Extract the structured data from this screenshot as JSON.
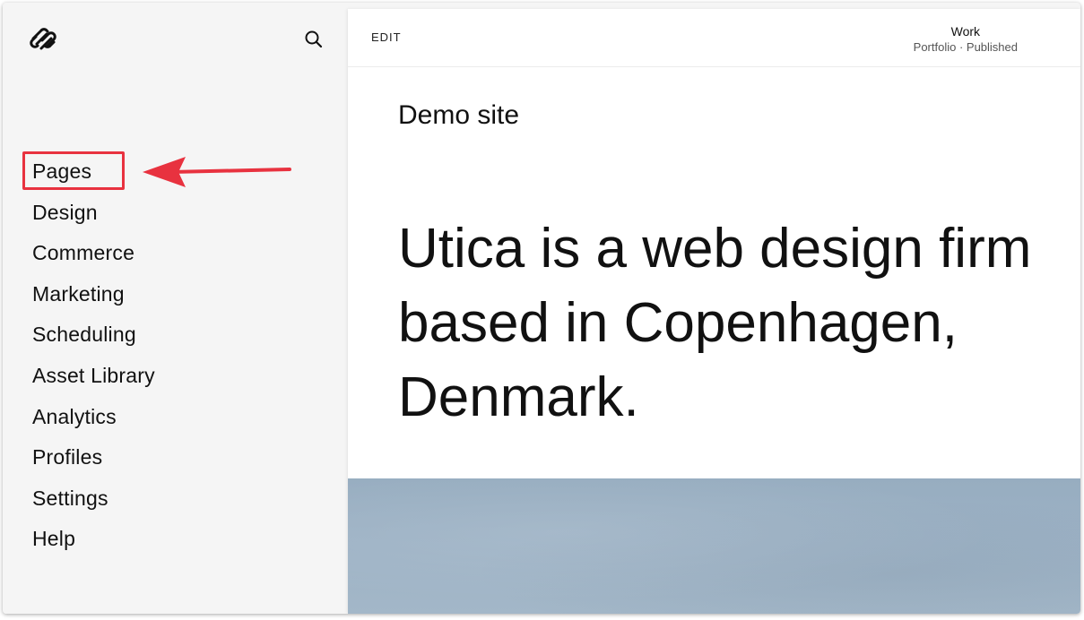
{
  "sidebar": {
    "logo_icon": "squarespace-logo-icon",
    "search_icon": "search-icon",
    "items": [
      {
        "label": "Pages"
      },
      {
        "label": "Design"
      },
      {
        "label": "Commerce"
      },
      {
        "label": "Marketing"
      },
      {
        "label": "Scheduling"
      },
      {
        "label": "Asset Library"
      },
      {
        "label": "Analytics"
      },
      {
        "label": "Profiles"
      },
      {
        "label": "Settings"
      },
      {
        "label": "Help"
      }
    ],
    "highlighted_item": "Pages"
  },
  "annotation": {
    "color": "#e8323f",
    "shape": "box-and-arrow"
  },
  "topbar": {
    "edit_label": "EDIT",
    "page_name": "Work",
    "page_status": "Portfolio · Published"
  },
  "content": {
    "site_name": "Demo site",
    "headline_lines": [
      "Utica is a web design firm",
      "based in Copenhagen,",
      "Denmark."
    ]
  },
  "colors": {
    "sidebar_bg": "#f5f5f5",
    "hero_image": "#9db2c5"
  }
}
